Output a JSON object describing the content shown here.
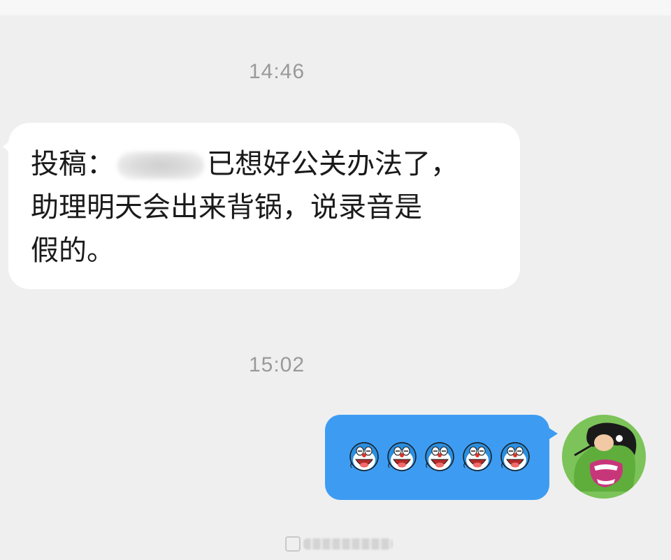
{
  "chat": {
    "timestamp_1": "14:46",
    "message_incoming": {
      "prefix": "投稿：",
      "redacted": true,
      "text": "已想好公关办法了，\n助理明天会出来背锅，说录音是\n假的。"
    },
    "timestamp_2": "15:02",
    "message_outgoing": {
      "emoji_count": 5,
      "emoji_name": "doraemon-laughing-icon"
    },
    "avatar": {
      "icon": "cartoon-avatar-icon"
    }
  },
  "colors": {
    "background": "#efefef",
    "incoming_bubble": "#ffffff",
    "outgoing_bubble": "#3d9cf2",
    "timestamp_text": "#9a9a9a"
  },
  "watermark": {
    "icon": "platform-logo-icon"
  }
}
